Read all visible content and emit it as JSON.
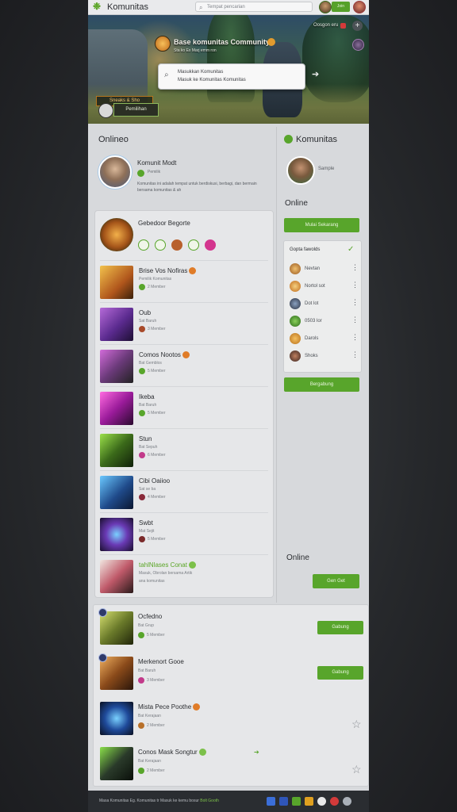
{
  "topbar": {
    "brand": "Komunitas",
    "search_placeholder": "Tempat pencarian",
    "join_label": "Join"
  },
  "hero": {
    "title": "Base komunitas Community",
    "subtitle": "Sta ko Ex Marj emm ron",
    "tag": "Oosgon eru",
    "search_line1": "Masukkan Komunitas",
    "search_line2": "Masuk ke Komunitas Komunitas",
    "chip_label": "Sneaks & Sho",
    "button_label": "Pemilihan"
  },
  "left": {
    "section_title": "Onlineo",
    "owner": {
      "name": "Komunit Modt",
      "role": "Pemilik",
      "description": "Komunitas ini adalah tempat untuk berdiskusi, berbagi, dan bermain bersama komunitas & ah"
    },
    "list_header": {
      "title": "Gebedoor Begorte"
    },
    "items": [
      {
        "title": "Brise Vos Nofiras",
        "sub": "Pemilik Komunitas",
        "meta": "2 Member",
        "badge": true
      },
      {
        "title": "Oub",
        "sub": "Sat Baruh",
        "meta": "3 Member",
        "badge": false
      },
      {
        "title": "Comos Nootos",
        "sub": "Bat Gemblos",
        "meta": "5 Member",
        "badge": true
      },
      {
        "title": "Ikeba",
        "sub": "Bat Baruh",
        "meta": "5 Member",
        "badge": false
      },
      {
        "title": "Stun",
        "sub": "Bat Sepuh",
        "meta": "6 Member",
        "badge": false
      },
      {
        "title": "Cibi Oaiioo",
        "sub": "Sat se ba",
        "meta": "4 Member",
        "badge": false
      },
      {
        "title": "Swbt",
        "sub": "Mat Sejit",
        "meta": "5 Member",
        "badge": false
      },
      {
        "title": "tahlNlases Conat",
        "sub": "Masuk, Obrolan bersama Artik",
        "meta": "ana komunitas",
        "badge": true,
        "green": true
      }
    ]
  },
  "right": {
    "section_title": "Komunitas",
    "avatar_label": "Sample",
    "online_label": "Online",
    "primary_button": "Mulai Sekarang",
    "panel_title": "Gopta fawolds",
    "members": [
      {
        "name": "Nevtan"
      },
      {
        "name": "Nortol sot"
      },
      {
        "name": "Dot lot"
      },
      {
        "name": "0503 lor"
      },
      {
        "name": "Darols"
      },
      {
        "name": "Shoks"
      }
    ],
    "secondary_button": "Bergabung",
    "online_label_2": "Online",
    "small_button": "Gen Get"
  },
  "bottom": {
    "items": [
      {
        "title": "Ocfedno",
        "sub": "Bat Grup",
        "meta": "5 Member",
        "action": "Gabung"
      },
      {
        "title": "Merkenort Gooe",
        "sub": "Bat Baruh",
        "meta": "3 Member",
        "action": "Gabung"
      },
      {
        "title": "Mista Pece Poothe",
        "sub": "Bat Kerajaan",
        "meta": "2 Member",
        "action": ""
      },
      {
        "title": "Conos Mask Songtur",
        "sub": "Bat Kerajaan",
        "meta": "2 Member",
        "action": ""
      }
    ]
  },
  "footer": {
    "text": "Masa Komunitas Eg. Komunitas tr Masuk ke kemu bosur",
    "highlight": "Bolt Gooth"
  },
  "colors": {
    "accent": "#58a52b",
    "background": "#d7d9dc",
    "footer": "#2a2d31"
  },
  "icons": {
    "brand": "leaf-icon",
    "search": "search-icon",
    "add": "plus-icon",
    "favorite": "star-icon",
    "more": "more-vertical-icon"
  }
}
